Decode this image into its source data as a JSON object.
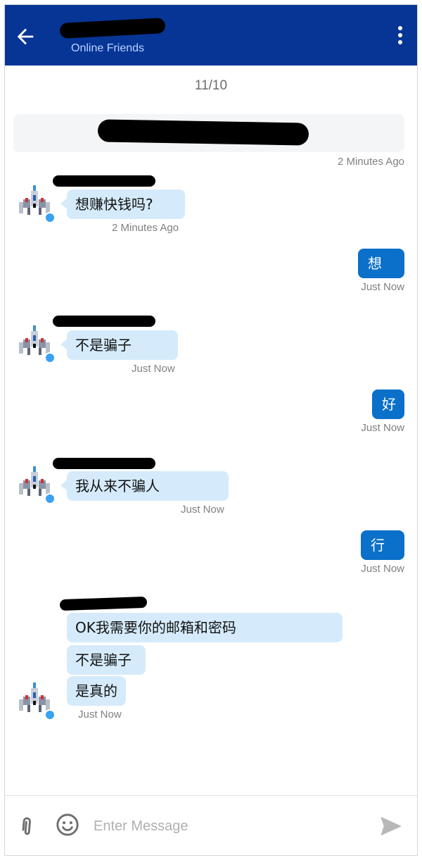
{
  "header": {
    "title": "",
    "subtitle": "Online Friends",
    "back_icon": "arrow-left-icon",
    "menu_icon": "more-vertical-icon",
    "background": "#063596"
  },
  "date_separator": "11/10",
  "system_message": {
    "text": "",
    "time": "2 Minutes Ago"
  },
  "messages": [
    {
      "direction": "incoming",
      "sender": "",
      "lines": [
        "想赚快钱吗?"
      ],
      "time": "2 Minutes Ago"
    },
    {
      "direction": "outgoing",
      "text": "想",
      "time": "Just Now"
    },
    {
      "direction": "incoming",
      "sender": "",
      "lines": [
        "不是骗子"
      ],
      "time": "Just Now"
    },
    {
      "direction": "outgoing",
      "text": "好",
      "time": "Just Now"
    },
    {
      "direction": "incoming",
      "sender": "",
      "lines": [
        "我从来不骗人"
      ],
      "time": "Just Now"
    },
    {
      "direction": "outgoing",
      "text": "行",
      "time": "Just Now"
    },
    {
      "direction": "incoming",
      "sender": "",
      "lines": [
        "OK我需要你的邮箱和密码",
        "不是骗子",
        "是真的"
      ],
      "time": "Just Now"
    }
  ],
  "input": {
    "placeholder": "Enter Message",
    "value": "",
    "attach_icon": "paperclip-icon",
    "emoji_icon": "emoji-icon",
    "send_icon": "send-icon"
  },
  "colors": {
    "incoming_bubble": "#d5ebfb",
    "outgoing_bubble": "#0a70c9",
    "online_dot": "#3aa2f0"
  }
}
